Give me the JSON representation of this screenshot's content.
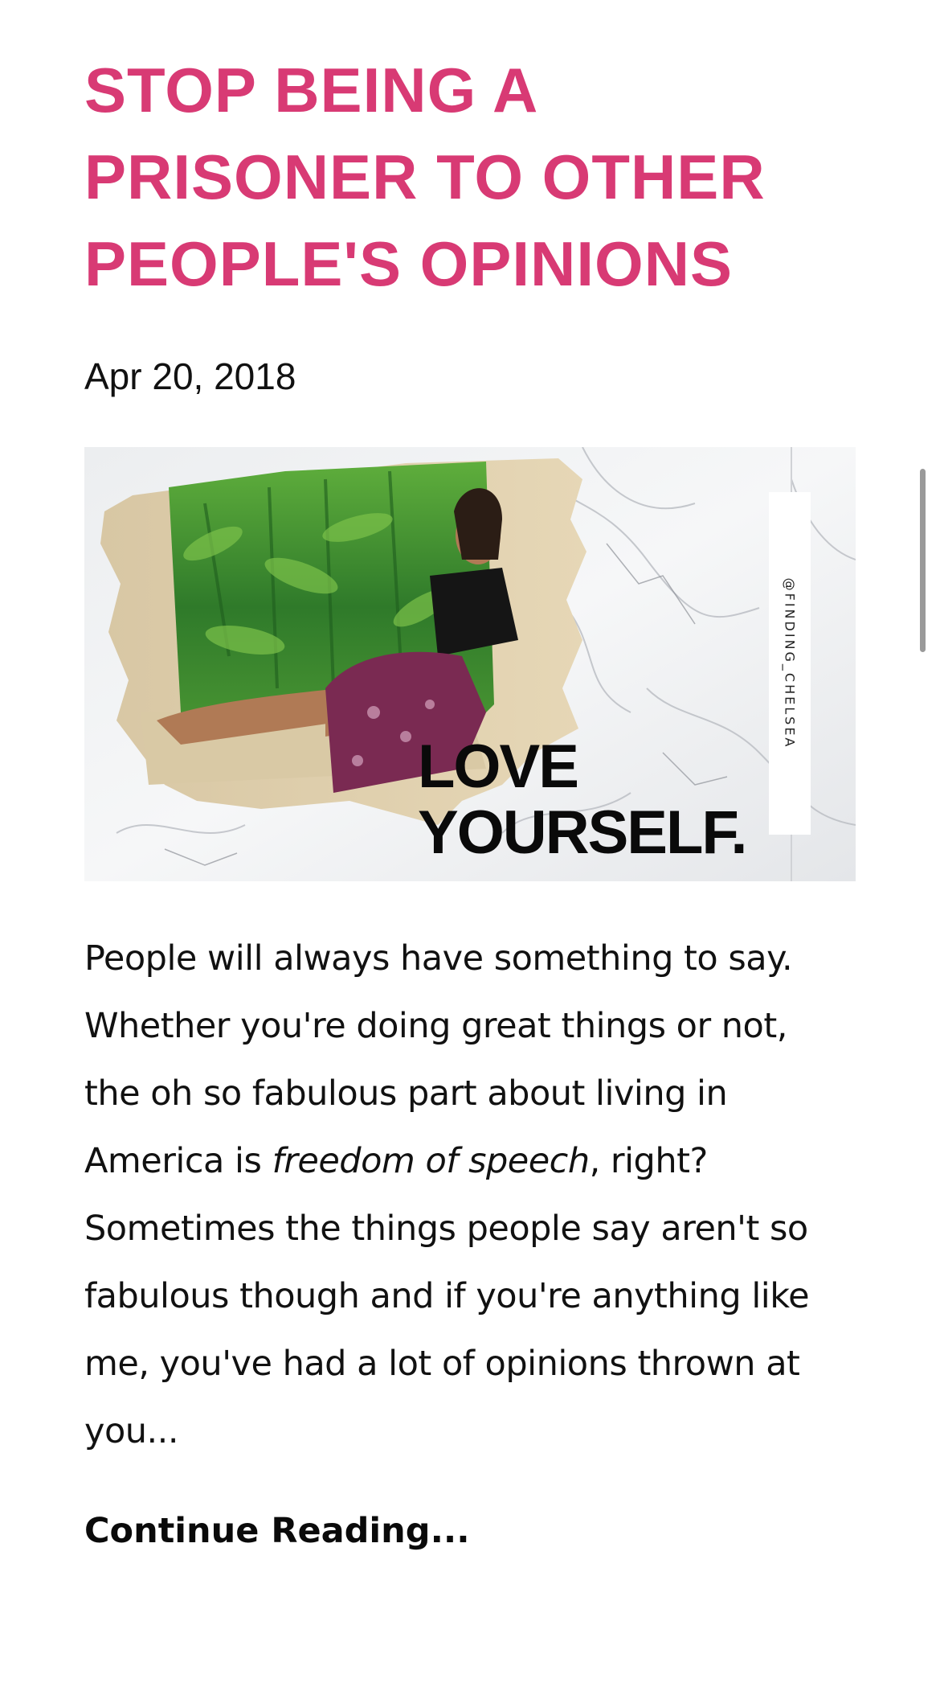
{
  "post": {
    "title_lines": [
      "STOP BEING A",
      "PRISONER TO OTHER",
      "PEOPLE'S OPINIONS"
    ],
    "date": "Apr 20, 2018",
    "image": {
      "overlay_line1": "LOVE",
      "overlay_line2": "YOURSELF.",
      "handle": "@FINDING_CHELSEA"
    },
    "excerpt": {
      "line1": "People will always have something to say.",
      "line2": "Whether you're doing great things or not,",
      "line3": "the oh so fabulous part about living in",
      "line4_before": "America is ",
      "line4_italic": "freedom of speech",
      "line4_after": ", right?",
      "line5": "Sometimes the things people say aren't so",
      "line6": "fabulous though and if you're anything like",
      "line7": "me, you've had a lot of opinions thrown at",
      "line8": "you..."
    },
    "continue_label": "Continue Reading..."
  },
  "colors": {
    "title": "#d83a74",
    "text": "#111111"
  }
}
